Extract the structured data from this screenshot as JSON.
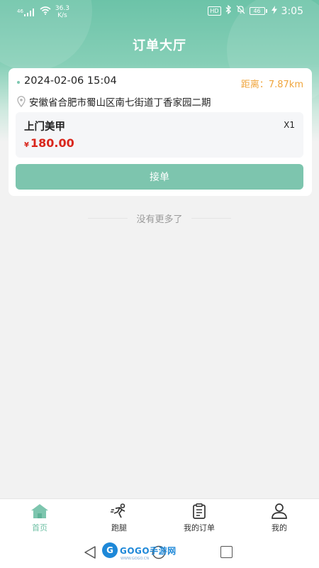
{
  "status_bar": {
    "signal": "46",
    "net_speed_value": "36.3",
    "net_speed_unit": "K/s",
    "hd": "HD",
    "battery": "46",
    "time": "3:05"
  },
  "header": {
    "title": "订单大厅"
  },
  "orders": [
    {
      "time": "2024-02-06 15:04",
      "distance": "距离：7.87km",
      "address": "安徽省合肥市蜀山区南七街道丁香家园二期",
      "service": "上门美甲",
      "quantity": "X1",
      "currency": "¥",
      "price": "180.00",
      "accept_label": "接单"
    }
  ],
  "list_end_text": "没有更多了",
  "tabbar": {
    "items": [
      {
        "label": "首页",
        "icon": "home-icon",
        "active": true
      },
      {
        "label": "跑腿",
        "icon": "runner-icon",
        "active": false
      },
      {
        "label": "我的订单",
        "icon": "clipboard-icon",
        "active": false
      },
      {
        "label": "我的",
        "icon": "user-icon",
        "active": false
      }
    ]
  },
  "watermark": {
    "logo_letter": "G",
    "text": "GOGO手游网",
    "subtext": "WWW.GOGO.CN"
  },
  "colors": {
    "accent": "#7dc5ae",
    "price": "#d9261c",
    "distance": "#f0a53c"
  }
}
